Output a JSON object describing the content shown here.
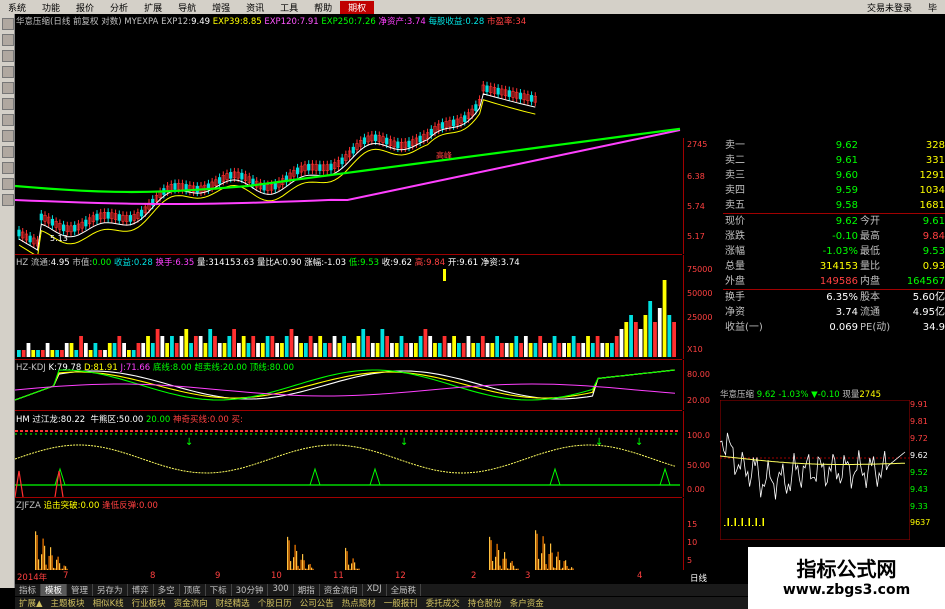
{
  "menu": [
    "系统",
    "功能",
    "报价",
    "分析",
    "扩展",
    "导航",
    "增强",
    "资讯",
    "工具",
    "帮助",
    "期权"
  ],
  "menu_active": "期权",
  "menu_right": [
    "交易未登录",
    "毕"
  ],
  "info": {
    "name": "华意压缩(日线 前复权 对数)",
    "indicator": "MYEXPA",
    "exp12_label": "EXP12:",
    "exp12": "9.49",
    "exp39_label": "EXP39:",
    "exp39": "8.85",
    "exp120_label": "EXP120:",
    "exp120": "7.91",
    "exp250_label": "EXP250:",
    "exp250": "7.26",
    "navps_label": "净资产:",
    "navps": "3.74",
    "eps_label": "每股收益:",
    "eps": "0.28",
    "pe_label": "市盈率:",
    "pe": "34"
  },
  "main_chart": {
    "low_label": "5.13",
    "peak_label": "高峰",
    "axis": [
      "2745",
      "6.38",
      "5.74",
      "5.17"
    ]
  },
  "vol_panel": {
    "title": "HZ 流通:",
    "title_val": "4.95",
    "mcap_label": "市值:",
    "mcap": "0.00",
    "profit_label": "收益:",
    "profit": "0.28",
    "turn_label": "换手:",
    "turn": "6.35",
    "vol_label": "量:",
    "vol": "314153.63",
    "ratio_label": "量比A:",
    "ratio": "0.90",
    "zf_label": "涨幅:",
    "zf": "-1.03",
    "low_label": "低:",
    "low": "9.53",
    "close_label": "收:",
    "close": "9.62",
    "high_label": "高:",
    "high": "9.84",
    "open_label": "开:",
    "open": "9.61",
    "nav_label": "净资:",
    "nav": "3.74",
    "axis": [
      "75000",
      "50000",
      "25000",
      "X10"
    ],
    "bars": [
      1,
      1,
      2,
      1,
      1,
      1,
      2,
      1,
      1,
      1,
      2,
      2,
      1,
      3,
      2,
      1,
      2,
      1,
      1,
      2,
      2,
      3,
      2,
      1,
      1,
      2,
      2,
      3,
      2,
      4,
      3,
      2,
      3,
      2,
      3,
      4,
      2,
      3,
      3,
      2,
      4,
      3,
      2,
      2,
      3,
      4,
      2,
      3,
      2,
      3,
      2,
      2,
      3,
      3,
      2,
      2,
      3,
      4,
      3,
      2,
      2,
      3,
      2,
      3,
      2,
      2,
      3,
      2,
      3,
      2,
      2,
      3,
      4,
      3,
      2,
      2,
      4,
      3,
      2,
      2,
      3,
      2,
      2,
      2,
      3,
      4,
      3,
      2,
      2,
      3,
      2,
      3,
      2,
      2,
      3,
      2,
      2,
      3,
      2,
      2,
      3,
      2,
      2,
      2,
      3,
      2,
      3,
      2,
      2,
      3,
      2,
      2,
      3,
      2,
      2,
      2,
      3,
      2,
      2,
      3,
      2,
      3,
      2,
      2,
      2,
      3,
      4,
      5,
      6,
      5,
      4,
      6,
      8,
      5,
      7,
      11,
      6,
      5
    ]
  },
  "kdj_panel": {
    "title": "HZ-KDJ",
    "k_label": "K:",
    "k": "79.78",
    "d_label": "D:",
    "d": "81.91",
    "j_label": "J:",
    "j": "71.66",
    "bottom_label": "底线:",
    "bottom": "8.00",
    "overbought_label": "超卖线:",
    "overbought": "20.00",
    "top_label": "顶线:",
    "top": "80.00",
    "axis": [
      "80.00",
      "20.00"
    ]
  },
  "hm_panel": {
    "title": "HM 过江龙:",
    "val": "80.22",
    "bull_label": "牛熊区:",
    "bull": "50.00",
    "v20": "20.00",
    "signal_label": "神奇买线:",
    "signal": "0.00",
    "buy_label": "买:",
    "buy": "",
    "axis": [
      "100.0",
      "50.00",
      "0.00"
    ]
  },
  "zjfza_panel": {
    "title": "ZJFZA",
    "break_label": "追击突破:",
    "break": "0.00",
    "rebound_label": "逢低反弹:",
    "rebound": "0.00",
    "axis": [
      "15",
      "10",
      "5"
    ]
  },
  "dates": [
    "2014年",
    "7",
    "8",
    "9",
    "10",
    "11",
    "12",
    "2",
    "3",
    "4"
  ],
  "day_label": "日线",
  "quote": {
    "asks": [
      {
        "label": "卖五",
        "price": "9.58",
        "vol": "1681"
      },
      {
        "label": "卖四",
        "price": "9.59",
        "vol": "1034"
      },
      {
        "label": "卖三",
        "price": "9.60",
        "vol": "1291"
      },
      {
        "label": "卖二",
        "price": "9.61",
        "vol": "331"
      },
      {
        "label": "卖一",
        "price": "9.62",
        "vol": "328"
      }
    ],
    "rows": [
      {
        "l1": "现价",
        "v1": "9.62",
        "l2": "今开",
        "v2": "9.61",
        "c1": "#00ff00",
        "c2": "#00ff00"
      },
      {
        "l1": "涨跌",
        "v1": "-0.10",
        "l2": "最高",
        "v2": "9.84",
        "c1": "#00ff00",
        "c2": "#ff4040"
      },
      {
        "l1": "涨幅",
        "v1": "-1.03%",
        "l2": "最低",
        "v2": "9.53",
        "c1": "#00ff00",
        "c2": "#00ff00"
      },
      {
        "l1": "总量",
        "v1": "314153",
        "l2": "量比",
        "v2": "0.93",
        "c1": "#ffff00",
        "c2": "#ffff00"
      },
      {
        "l1": "外盘",
        "v1": "149586",
        "l2": "内盘",
        "v2": "164567",
        "c1": "#ff4040",
        "c2": "#00ff00"
      }
    ],
    "rows2": [
      {
        "l1": "换手",
        "v1": "6.35%",
        "l2": "股本",
        "v2": "5.60亿"
      },
      {
        "l1": "净资",
        "v1": "3.74",
        "l2": "流通",
        "v2": "4.95亿"
      },
      {
        "l1": "收益(一)",
        "v1": "0.069",
        "l2": "PE(动)",
        "v2": "34.9"
      }
    ]
  },
  "mini_chart": {
    "title": "华意压缩",
    "price": "9.62",
    "pct": "-1.03%",
    "chg": "▼-0.10",
    "vol_label": "现量",
    "vol": "2745",
    "axis": [
      "9.91",
      "9.81",
      "9.72",
      "9.62",
      "9.52",
      "9.43",
      "9.33"
    ],
    "vol_axis": [
      "9637"
    ]
  },
  "tabs1": [
    "指标",
    "模板",
    "管理",
    "另存为",
    "博弈",
    "多空",
    "顶底",
    "下标",
    "30分钟",
    "300",
    "期指",
    "资金流向",
    "XDJ",
    "全局秩"
  ],
  "tabs1_active": "模板",
  "tabs2": [
    "扩展▲",
    "主题板块",
    "相似K线",
    "行业板块",
    "资金流向",
    "财经精选",
    "个股日历",
    "公司公告",
    "热点题材",
    "一般报刊",
    "委托成交",
    "持仓股份",
    "条户资金"
  ],
  "watermark": {
    "line1": "指标公式网",
    "line2": "www.zbgs3.com"
  }
}
